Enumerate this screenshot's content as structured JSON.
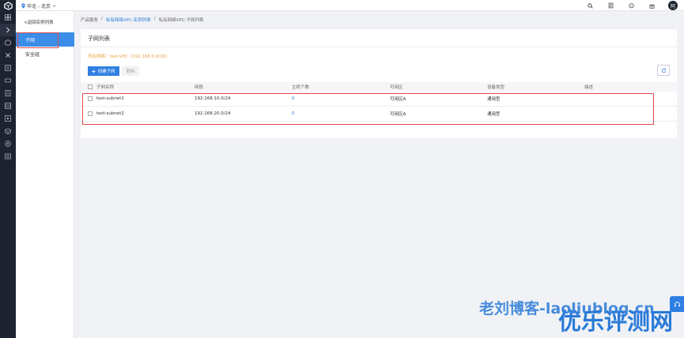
{
  "topbar": {
    "region": "华北 - 北京",
    "avatar_initial": "阿"
  },
  "rail": {
    "icons": [
      "grid-icon",
      "chevron-right-icon",
      "box-icon",
      "network-icon",
      "list-icon",
      "card-icon",
      "db-icon",
      "table-icon",
      "play-icon",
      "cube-icon",
      "circle-icon",
      "shield-icon"
    ]
  },
  "sidebar": {
    "back_label": "<返回实例列表",
    "items": [
      {
        "label": "子网",
        "active": true
      },
      {
        "label": "安全组",
        "active": false
      }
    ]
  },
  "breadcrumb": {
    "items": [
      "产品服务",
      "私有网络VPC-实例列表",
      "私有网络VPC-子网列表"
    ],
    "sep": "/"
  },
  "panel": {
    "title": "子网列表",
    "vpc_info": "所在网络：test-VPC（192.168.0.0/16）",
    "create_label": "创建子网",
    "delete_label": "删除"
  },
  "table": {
    "headers": [
      "子网名称",
      "网段",
      "主机个数",
      "可用区",
      "设备类型",
      "描述"
    ],
    "rows": [
      {
        "name": "test-subnet1",
        "cidr": "192.168.10.0/24",
        "hosts": "0",
        "zone": "可用区A",
        "device": "通用型",
        "desc": ""
      },
      {
        "name": "test-subnet2",
        "cidr": "192.168.20.0/24",
        "hosts": "0",
        "zone": "可用区A",
        "device": "通用型",
        "desc": ""
      }
    ]
  },
  "watermark": {
    "line1": "老刘博客-laoliublog.cn",
    "line2": "优乐评测网"
  },
  "colors": {
    "accent": "#2f7fe3",
    "rail": "#1d2330",
    "warning": "#e8a13d",
    "highlight": "#e04b4b"
  }
}
